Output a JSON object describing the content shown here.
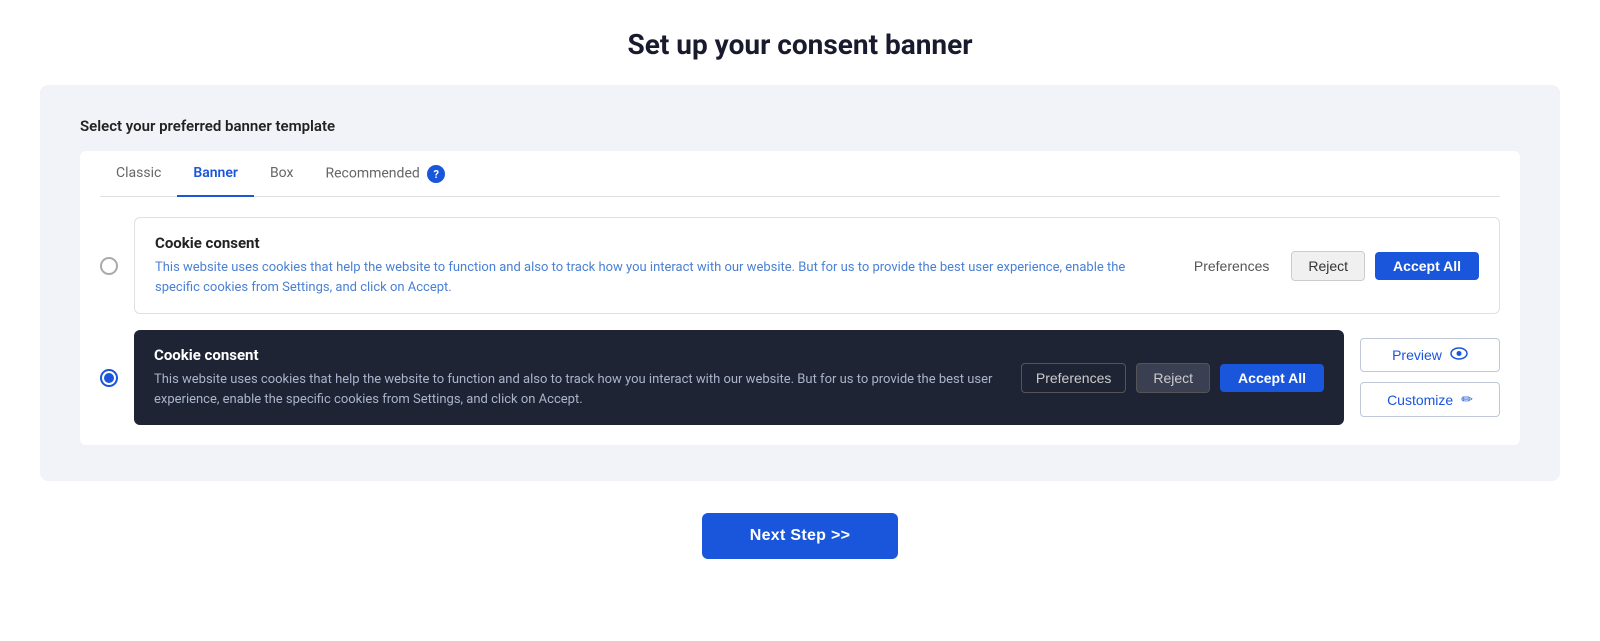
{
  "page": {
    "title": "Set up your consent banner"
  },
  "section": {
    "label": "Select your preferred banner template"
  },
  "tabs": [
    {
      "id": "classic",
      "label": "Classic",
      "active": false
    },
    {
      "id": "banner",
      "label": "Banner",
      "active": true
    },
    {
      "id": "box",
      "label": "Box",
      "active": false
    },
    {
      "id": "recommended",
      "label": "Recommended",
      "active": false
    }
  ],
  "templates": [
    {
      "id": "light",
      "selected": false,
      "title": "Cookie consent",
      "description": "This website uses cookies that help the website to function and also to track how you interact with our website. But for us to provide the best user experience, enable the specific cookies from Settings, and click on Accept.",
      "theme": "light",
      "buttons": {
        "preferences": "Preferences",
        "reject": "Reject",
        "accept_all": "Accept All"
      }
    },
    {
      "id": "dark",
      "selected": true,
      "title": "Cookie consent",
      "description": "This website uses cookies that help the website to function and also to track how you interact with our website. But for us to provide the best user experience, enable the specific cookies from Settings, and click on Accept.",
      "theme": "dark",
      "buttons": {
        "preferences": "Preferences",
        "reject": "Reject",
        "accept_all": "Accept All"
      }
    }
  ],
  "side_actions": {
    "preview_label": "Preview",
    "customize_label": "Customize"
  },
  "next_step": {
    "label": "Next Step >>"
  },
  "help_icon": "?"
}
